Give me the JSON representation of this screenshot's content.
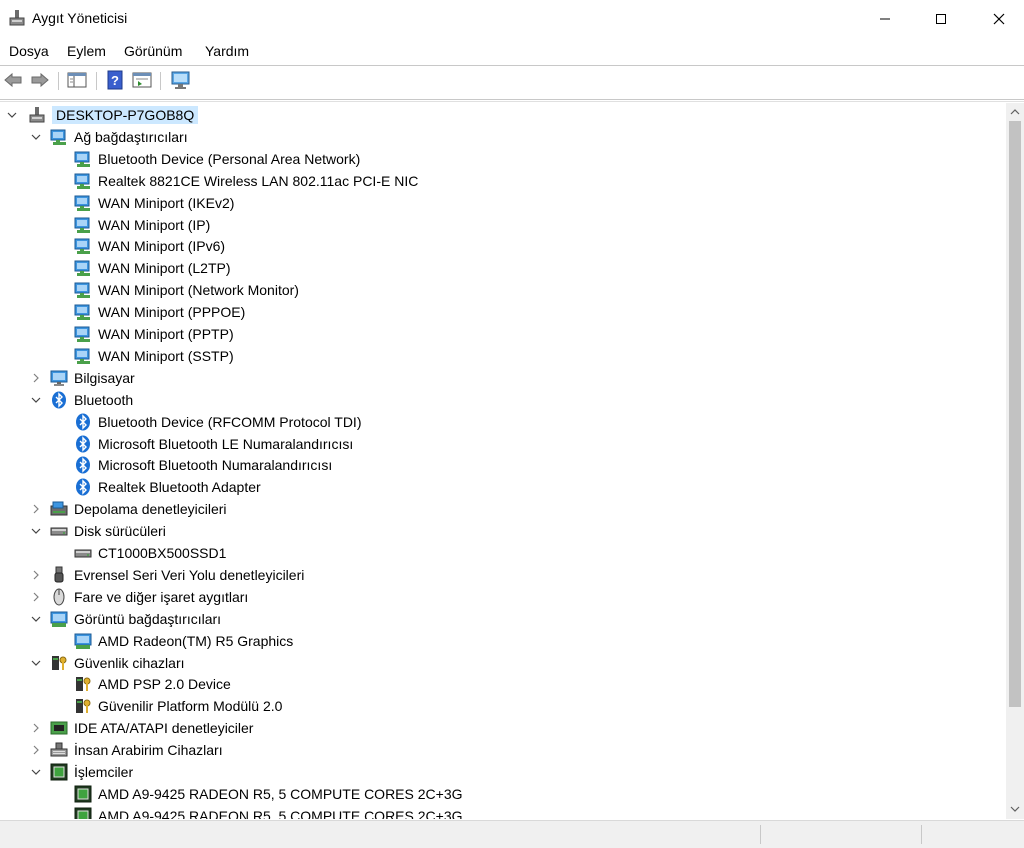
{
  "window": {
    "title": "Aygıt Yöneticisi"
  },
  "menu": {
    "file": "Dosya",
    "action": "Eylem",
    "view": "Görünüm",
    "help": "Yardım"
  },
  "tree": {
    "root": "DESKTOP-P7GOB8Q",
    "categories": [
      {
        "label": "Ağ bağdaştırıcıları",
        "icon": "network-adapter-icon",
        "expanded": true,
        "children": [
          "Bluetooth Device (Personal Area Network)",
          "Realtek 8821CE Wireless LAN 802.11ac PCI-E NIC",
          "WAN Miniport (IKEv2)",
          "WAN Miniport (IP)",
          "WAN Miniport (IPv6)",
          "WAN Miniport (L2TP)",
          "WAN Miniport (Network Monitor)",
          "WAN Miniport (PPPOE)",
          "WAN Miniport (PPTP)",
          "WAN Miniport (SSTP)"
        ]
      },
      {
        "label": "Bilgisayar",
        "icon": "computer-icon",
        "expanded": false,
        "children": []
      },
      {
        "label": "Bluetooth",
        "icon": "bluetooth-icon",
        "expanded": true,
        "children": [
          "Bluetooth Device (RFCOMM Protocol TDI)",
          "Microsoft Bluetooth LE Numaralandırıcısı",
          "Microsoft Bluetooth Numaralandırıcısı",
          "Realtek Bluetooth Adapter"
        ]
      },
      {
        "label": "Depolama denetleyicileri",
        "icon": "storage-controller-icon",
        "expanded": false,
        "children": []
      },
      {
        "label": "Disk sürücüleri",
        "icon": "disk-drive-icon",
        "expanded": true,
        "children": [
          "CT1000BX500SSD1"
        ]
      },
      {
        "label": "Evrensel Seri Veri Yolu denetleyicileri",
        "icon": "usb-icon",
        "expanded": false,
        "children": []
      },
      {
        "label": "Fare ve diğer işaret aygıtları",
        "icon": "mouse-icon",
        "expanded": false,
        "children": []
      },
      {
        "label": "Görüntü bağdaştırıcıları",
        "icon": "display-adapter-icon",
        "expanded": true,
        "children": [
          "AMD Radeon(TM) R5 Graphics"
        ]
      },
      {
        "label": "Güvenlik cihazları",
        "icon": "security-device-icon",
        "expanded": true,
        "children": [
          "AMD PSP 2.0 Device",
          "Güvenilir Platform Modülü 2.0"
        ]
      },
      {
        "label": "IDE ATA/ATAPI denetleyiciler",
        "icon": "ide-controller-icon",
        "expanded": false,
        "children": []
      },
      {
        "label": "İnsan Arabirim Cihazları",
        "icon": "hid-icon",
        "expanded": false,
        "children": []
      },
      {
        "label": "İşlemciler",
        "icon": "processor-icon",
        "expanded": true,
        "children": [
          "AMD A9-9425 RADEON R5, 5 COMPUTE CORES 2C+3G",
          "AMD A9-9425 RADEON R5, 5 COMPUTE CORES 2C+3G"
        ]
      }
    ]
  },
  "colors": {
    "selection": "#cce8ff",
    "accent": "#0078d7"
  }
}
